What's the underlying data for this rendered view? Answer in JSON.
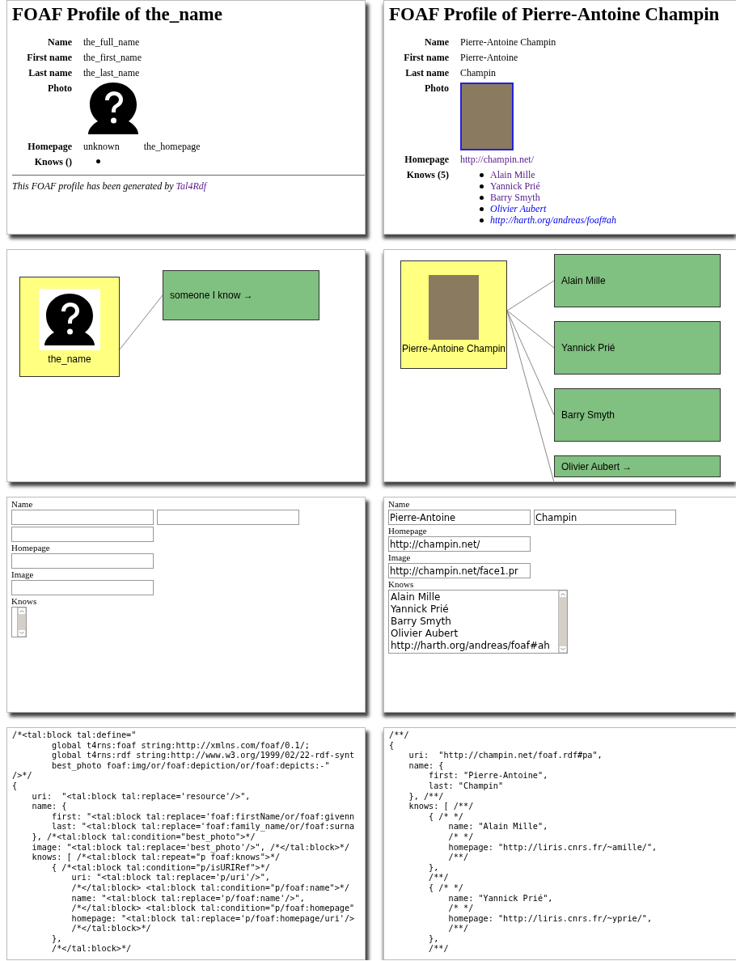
{
  "panels": [
    {
      "kind": "profile",
      "title": "FOAF Profile of the_name",
      "fields": [
        {
          "label": "Name",
          "value": "the_full_name"
        },
        {
          "label": "First name",
          "value": "the_first_name"
        },
        {
          "label": "Last name",
          "value": "the_last_name"
        }
      ],
      "photo": {
        "label": "Photo",
        "kind": "unknown"
      },
      "homepage": {
        "label": "Homepage",
        "values": [
          {
            "text": "unknown",
            "link": false
          },
          {
            "text": "the_homepage",
            "link": false
          }
        ]
      },
      "knows": {
        "label": "Knows ()",
        "empty_bullet": true
      },
      "footer": {
        "text": "This FOAF profile has been generated by",
        "link": "Tal4Rdf"
      }
    },
    {
      "kind": "profile",
      "title": "FOAF Profile of Pierre-Antoine Champin",
      "fields": [
        {
          "label": "Name",
          "value": "Pierre-Antoine Champin"
        },
        {
          "label": "First name",
          "value": "Pierre-Antoine"
        },
        {
          "label": "Last name",
          "value": "Champin"
        }
      ],
      "photo": {
        "label": "Photo",
        "kind": "photo"
      },
      "homepage": {
        "label": "Homepage",
        "values": [
          {
            "text": "http://champin.net/",
            "link": true
          }
        ]
      },
      "knows": {
        "label": "Knows (5)",
        "items": [
          {
            "text": "Alain Mille",
            "visited": true
          },
          {
            "text": "Yannick Prié",
            "visited": true
          },
          {
            "text": "Barry Smyth",
            "visited": true
          },
          {
            "text": "Olivier Aubert",
            "visited": false
          },
          {
            "text": "http://harth.org/andreas/foaf#ah",
            "visited": false
          }
        ]
      }
    },
    {
      "kind": "graph",
      "center": {
        "name": "the_name",
        "kind": "unknown"
      },
      "nodes": [
        "someone I know →"
      ]
    },
    {
      "kind": "graph",
      "center": {
        "name": "Pierre-Antoine Champin",
        "kind": "photo"
      },
      "nodes": [
        "Alain Mille",
        "Yannick Prié",
        "Barry Smyth",
        "Olivier Aubert →"
      ]
    },
    {
      "kind": "form",
      "fields": [
        {
          "kind": "text",
          "label": "Name",
          "inputs": [
            {
              "kind": "text"
            },
            {
              "kind": "text"
            },
            {
              "kind": "text"
            }
          ]
        },
        {
          "kind": "text",
          "label": "Homepage",
          "inputs": [
            {
              "kind": "text"
            }
          ]
        },
        {
          "kind": "text",
          "label": "Image",
          "inputs": [
            {
              "kind": "text"
            }
          ]
        },
        {
          "kind": "list",
          "label": "Knows"
        }
      ]
    },
    {
      "kind": "form",
      "fields": [
        {
          "kind": "text",
          "label": "Name",
          "inputs": [
            {
              "kind": "text",
              "value": "Pierre-Antoine"
            },
            {
              "kind": "text",
              "value": "Champin"
            }
          ]
        },
        {
          "kind": "text",
          "label": "Homepage",
          "inputs": [
            {
              "kind": "text",
              "value": "http://champin.net/"
            }
          ]
        },
        {
          "kind": "text",
          "label": "Image",
          "inputs": [
            {
              "kind": "text",
              "value": "http://champin.net/face1.pr"
            }
          ]
        },
        {
          "kind": "list",
          "label": "Knows",
          "items": [
            "Alain Mille",
            "Yannick Prié",
            "Barry Smyth",
            "Olivier Aubert",
            "http://harth.org/andreas/foaf#ah"
          ]
        }
      ]
    },
    {
      "kind": "code",
      "lines": [
        "/*<tal:block tal:define=\"",
        "        global t4rns:foaf string:http://xmlns.com/foaf/0.1/;",
        "        global t4rns:rdf string:http://www.w3.org/1999/02/22-rdf-synt",
        "        best_photo foaf:img/or/foaf:depiction/or/foaf:depicts:-\"",
        "/>*/",
        "{",
        "    uri:  \"<tal:block tal:replace='resource'/>\",",
        "    name: {",
        "        first: \"<tal:block tal:replace='foaf:firstName/or/foaf:givenn",
        "        last: \"<tal:block tal:replace='foaf:family_name/or/foaf:surna",
        "    }, /*<tal:block tal:condition=\"best_photo\">*/",
        "    image: \"<tal:block tal:replace='best_photo'/>\", /*</tal:block>*/",
        "    knows: [ /*<tal:block tal:repeat=\"p foaf:knows\">*/",
        "        { /*<tal:block tal:condition=\"p/isURIRef\">*/",
        "            uri: \"<tal:block tal:replace='p/uri'/>\",",
        "            /*</tal:block> <tal:block tal:condition=\"p/foaf:name\">*/",
        "            name: \"<tal:block tal:replace='p/foaf:name'/>\",",
        "            /*</tal:block> <tal:block tal:condition=\"p/foaf:homepage\"",
        "            homepage: \"<tal:block tal:replace='p/foaf:homepage/uri'/>",
        "            /*</tal:block>*/",
        "        },",
        "        /*</tal:block>*/"
      ]
    },
    {
      "kind": "code",
      "lines": [
        "/**/",
        "{",
        "    uri:  \"http://champin.net/foaf.rdf#pa\",",
        "    name: {",
        "        first: \"Pierre-Antoine\",",
        "        last: \"Champin\"",
        "    }, /**/",
        "    knows: [ /**/",
        "        { /* */",
        "            name: \"Alain Mille\",",
        "            /* */",
        "            homepage: \"http://liris.cnrs.fr/~amille/\",",
        "            /**/",
        "        },",
        "        /**/",
        "        { /* */",
        "            name: \"Yannick Prié\",",
        "            /* */",
        "            homepage: \"http://liris.cnrs.fr/~yprie/\",",
        "            /**/",
        "        },",
        "        /**/"
      ]
    }
  ]
}
